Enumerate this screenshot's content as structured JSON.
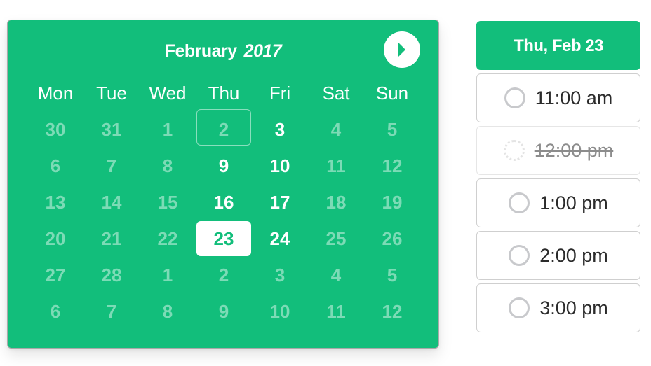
{
  "calendar": {
    "month": "February",
    "year": "2017",
    "next_icon": "chevron-right-circle-icon",
    "weekdays": [
      "Mon",
      "Tue",
      "Wed",
      "Thu",
      "Fri",
      "Sat",
      "Sun"
    ],
    "weeks": [
      [
        {
          "d": "30",
          "s": "other"
        },
        {
          "d": "31",
          "s": "other"
        },
        {
          "d": "1",
          "s": "unavail"
        },
        {
          "d": "2",
          "s": "today"
        },
        {
          "d": "3",
          "s": "avail"
        },
        {
          "d": "4",
          "s": "unavail"
        },
        {
          "d": "5",
          "s": "unavail"
        }
      ],
      [
        {
          "d": "6",
          "s": "unavail"
        },
        {
          "d": "7",
          "s": "unavail"
        },
        {
          "d": "8",
          "s": "unavail"
        },
        {
          "d": "9",
          "s": "avail"
        },
        {
          "d": "10",
          "s": "avail"
        },
        {
          "d": "11",
          "s": "unavail"
        },
        {
          "d": "12",
          "s": "unavail"
        }
      ],
      [
        {
          "d": "13",
          "s": "unavail"
        },
        {
          "d": "14",
          "s": "unavail"
        },
        {
          "d": "15",
          "s": "unavail"
        },
        {
          "d": "16",
          "s": "avail"
        },
        {
          "d": "17",
          "s": "avail"
        },
        {
          "d": "18",
          "s": "unavail"
        },
        {
          "d": "19",
          "s": "unavail"
        }
      ],
      [
        {
          "d": "20",
          "s": "unavail"
        },
        {
          "d": "21",
          "s": "unavail"
        },
        {
          "d": "22",
          "s": "unavail"
        },
        {
          "d": "23",
          "s": "selected"
        },
        {
          "d": "24",
          "s": "avail"
        },
        {
          "d": "25",
          "s": "unavail"
        },
        {
          "d": "26",
          "s": "unavail"
        }
      ],
      [
        {
          "d": "27",
          "s": "unavail"
        },
        {
          "d": "28",
          "s": "unavail"
        },
        {
          "d": "1",
          "s": "other"
        },
        {
          "d": "2",
          "s": "other"
        },
        {
          "d": "3",
          "s": "other"
        },
        {
          "d": "4",
          "s": "other"
        },
        {
          "d": "5",
          "s": "other"
        }
      ],
      [
        {
          "d": "6",
          "s": "other"
        },
        {
          "d": "7",
          "s": "other"
        },
        {
          "d": "8",
          "s": "other"
        },
        {
          "d": "9",
          "s": "other"
        },
        {
          "d": "10",
          "s": "other"
        },
        {
          "d": "11",
          "s": "other"
        },
        {
          "d": "12",
          "s": "other"
        }
      ]
    ]
  },
  "times": {
    "selected_date": "Thu, Feb 23",
    "slots": [
      {
        "label": "11:00 am",
        "disabled": false
      },
      {
        "label": "12:00 pm",
        "disabled": true
      },
      {
        "label": "1:00 pm",
        "disabled": false
      },
      {
        "label": "2:00 pm",
        "disabled": false
      },
      {
        "label": "3:00 pm",
        "disabled": false
      }
    ]
  },
  "colors": {
    "accent": "#12be7b",
    "text": "#2b2b2b",
    "border": "#cfcfcf"
  }
}
